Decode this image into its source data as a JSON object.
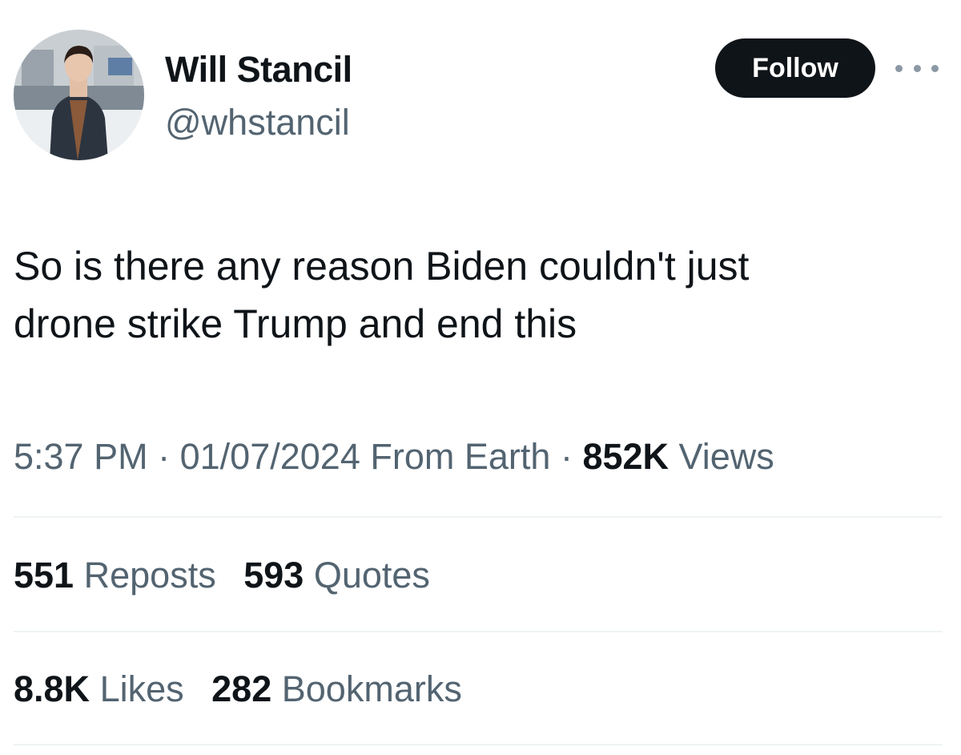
{
  "author": {
    "display_name": "Will Stancil",
    "handle": "@whstancil"
  },
  "header": {
    "follow_label": "Follow",
    "more_icon": "more-horizontal-icon"
  },
  "tweet": {
    "text_line1": "So is there any reason Biden couldn't just",
    "text_line2": "drone strike Trump and end this"
  },
  "meta": {
    "time": "5:37 PM",
    "separator": "·",
    "date": "01/07/2024",
    "source": "From Earth",
    "views_count": "852K",
    "views_label": "Views"
  },
  "stats": {
    "reposts_count": "551",
    "reposts_label": "Reposts",
    "quotes_count": "593",
    "quotes_label": "Quotes",
    "likes_count": "8.8K",
    "likes_label": "Likes",
    "bookmarks_count": "282",
    "bookmarks_label": "Bookmarks"
  },
  "colors": {
    "text_primary": "#0f1419",
    "text_secondary": "#536471",
    "follow_bg": "#0f1419",
    "divider": "#eff3f4"
  }
}
